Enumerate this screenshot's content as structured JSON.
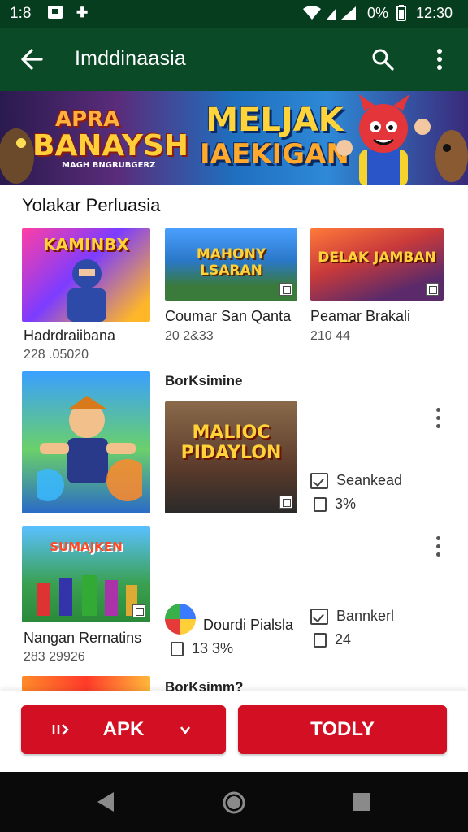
{
  "status_bar": {
    "time": "1:8",
    "battery": "0%",
    "clock": "12:30"
  },
  "app_bar": {
    "title": "Imddinaasia"
  },
  "banner": {
    "left_line1": "APRA",
    "left_line2": "BANAYSH",
    "left_line3": "MAGH BNGRUBGERZ",
    "mid_line1": "MELJAK",
    "mid_line2": "IAEKIGAN"
  },
  "section": {
    "title": "Yolakar Perluasia"
  },
  "grid": [
    {
      "title": "Hadrdraiibana",
      "sub": "228 .05020",
      "art": "KAMINBX"
    },
    {
      "title": "Coumar San Qanta",
      "sub": "20 2&33",
      "art": "MAHONY LSARAN"
    },
    {
      "title": "Peamar Brakali",
      "sub": "210 44",
      "art": "DELAK JAMBAN"
    }
  ],
  "list": [
    {
      "heading": "BorKsimine",
      "art": "MALIOC PIDAYLON",
      "stat1": "Seankead",
      "stat2": "3%"
    },
    {
      "title": "Nangan Rernatins",
      "sub": "283 29926",
      "art": "SUMAJKEN",
      "avatar_label": "Dourdi Pialsla",
      "avatar_stat": "13 3%",
      "stat1": "Bannkerl",
      "stat2": "24"
    },
    {
      "heading": "BorKsimm?"
    }
  ],
  "actions": {
    "apk_label": "APK",
    "primary_label": "TODLY"
  },
  "colors": {
    "status_bar": "#063d1f",
    "app_bar": "#0b4a26",
    "accent_red": "#d31023"
  }
}
